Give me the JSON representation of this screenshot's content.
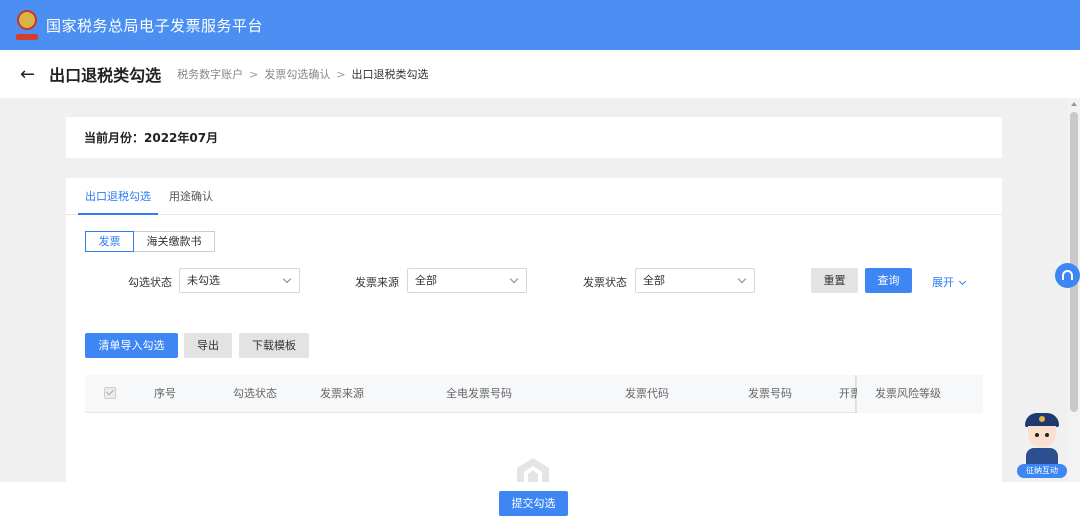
{
  "app": {
    "title": "国家税务总局电子发票服务平台"
  },
  "header": {
    "title": "出口退税类勾选",
    "breadcrumb": [
      "税务数字账户",
      "发票勾选确认",
      "出口退税类勾选"
    ]
  },
  "month": {
    "label": "当前月份：2022年07月"
  },
  "tabs": [
    {
      "label": "出口退税勾选",
      "active": true
    },
    {
      "label": "用途确认",
      "active": false
    }
  ],
  "doc_types": [
    {
      "label": "发票",
      "active": true
    },
    {
      "label": "海关缴款书",
      "active": false
    }
  ],
  "filters": {
    "select_status": {
      "label": "勾选状态",
      "value": "未勾选"
    },
    "invoice_source": {
      "label": "发票来源",
      "value": "全部"
    },
    "invoice_status": {
      "label": "发票状态",
      "value": "全部"
    }
  },
  "actions": {
    "reset": "重置",
    "query": "查询",
    "expand": "展开"
  },
  "toolbar": {
    "import": "清单导入勾选",
    "export": "导出",
    "download_template": "下载模板"
  },
  "table": {
    "columns": [
      "序号",
      "勾选状态",
      "发票来源",
      "全电发票号码",
      "发票代码",
      "发票号码",
      "开票",
      "发票风险等级"
    ]
  },
  "footer": {
    "submit": "提交勾选"
  },
  "assistant": {
    "label": "征纳互动"
  },
  "colors": {
    "primary": "#3d86f4",
    "topbar": "#4b8ff2"
  }
}
